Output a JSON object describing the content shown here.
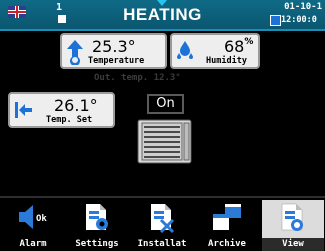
{
  "header": {
    "title": "HEATING",
    "page_number": "1",
    "date": "01-10-1",
    "time": "12:00:0"
  },
  "readings": {
    "temperature": {
      "value": "25.3°",
      "label": "Temperature",
      "icon": "thermometer-up-icon"
    },
    "humidity": {
      "value": "68",
      "unit": "%",
      "label": "Humidity",
      "icon": "water-drops-icon"
    },
    "out_temp": "Out. temp. 12.3°",
    "temp_set": {
      "value": "26.1°",
      "label": "Temp. Set",
      "icon": "arrow-left-icon"
    }
  },
  "device": {
    "status": "On",
    "icon": "heater-icon"
  },
  "nav": [
    {
      "label": "Alarm",
      "icon": "alarm-ok-icon",
      "badge": "Ok"
    },
    {
      "label": "Settings",
      "icon": "settings-doc-icon"
    },
    {
      "label": "Installat",
      "icon": "installation-doc-icon"
    },
    {
      "label": "Archive",
      "icon": "archive-windows-icon"
    },
    {
      "label": "View",
      "icon": "view-doc-icon",
      "active": true
    }
  ],
  "colors": {
    "header": "#0f6a86",
    "accent": "#1a8fb0",
    "icon_blue": "#1c72d6",
    "panel": "#eeeeee"
  }
}
